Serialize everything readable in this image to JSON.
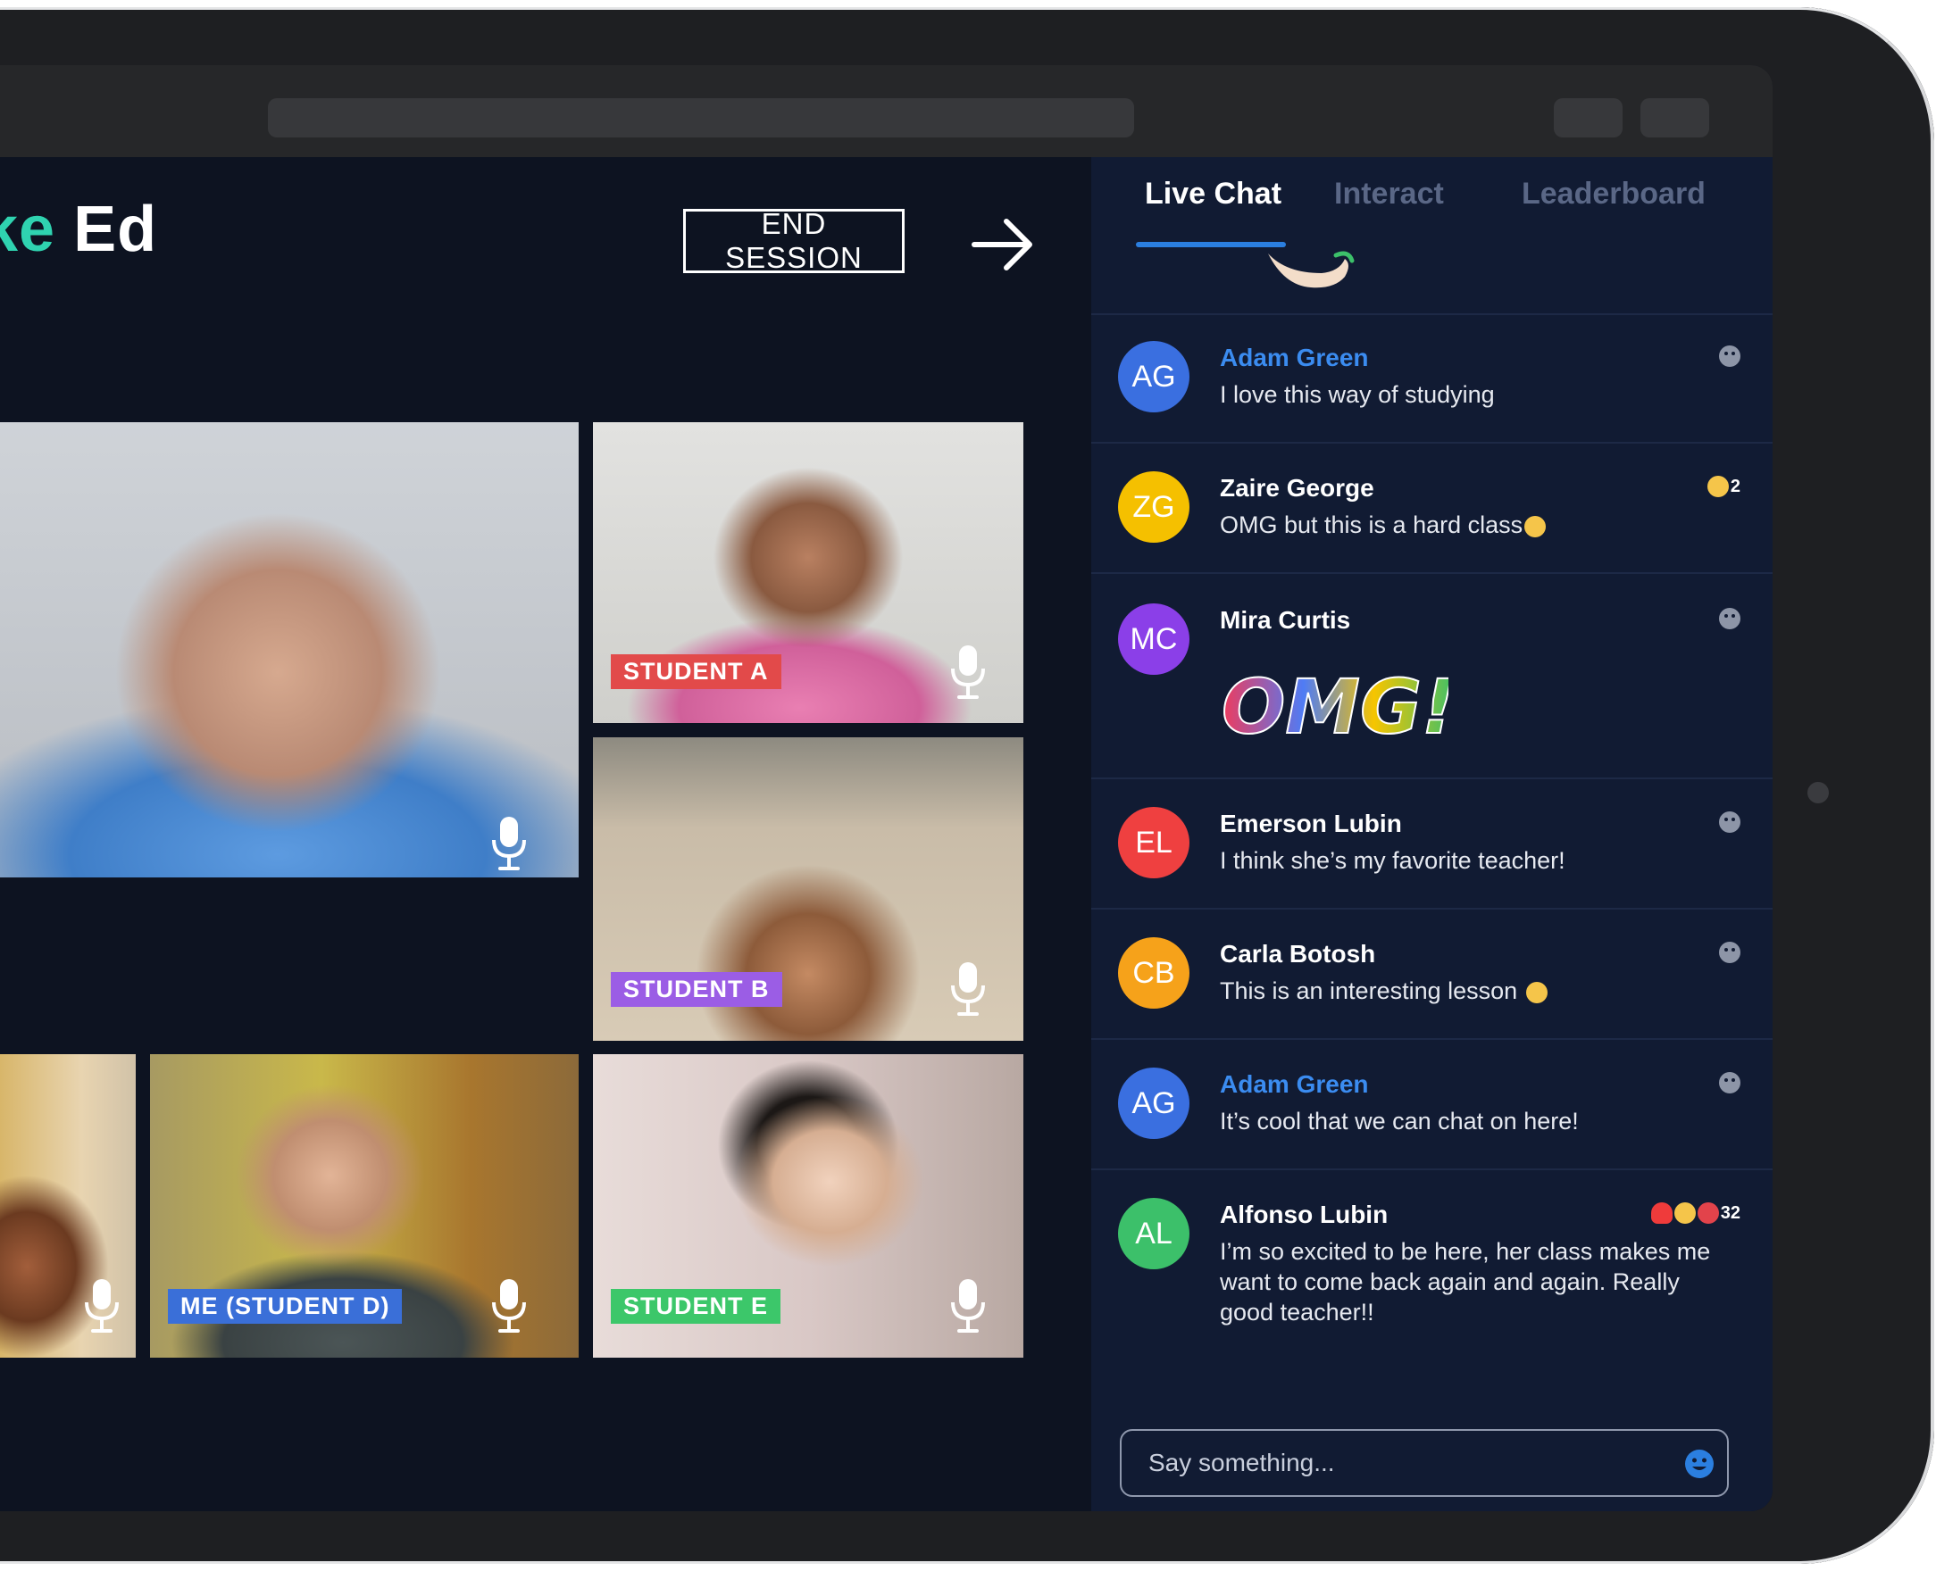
{
  "app": {
    "logo_accent": "ke",
    "logo_rest": "Ed",
    "end_session_label": "END SESSION"
  },
  "tiles": [
    {
      "id": "teacher",
      "label": ""
    },
    {
      "id": "student-a",
      "label": "STUDENT A",
      "tag_color": "#e24a4a"
    },
    {
      "id": "student-b",
      "label": "STUDENT B",
      "tag_color": "#9b5de5"
    },
    {
      "id": "student-c",
      "label": ""
    },
    {
      "id": "student-d",
      "label": "ME (STUDENT D)",
      "tag_color": "#3a6fd8"
    },
    {
      "id": "student-e",
      "label": "STUDENT E",
      "tag_color": "#3cc76a"
    }
  ],
  "chat": {
    "tabs": [
      {
        "label": "Live Chat",
        "active": true
      },
      {
        "label": "Interact",
        "active": false
      },
      {
        "label": "Leaderboard",
        "active": false
      }
    ],
    "messages": [
      {
        "initials": "AG",
        "name": "Adam Green",
        "avatar_color": "#3a6fe0",
        "text": "I love this way of studying"
      },
      {
        "initials": "ZG",
        "name": "Zaire George",
        "avatar_color": "#f5c000",
        "text": "OMG but this is a hard class",
        "reaction_count": "2"
      },
      {
        "initials": "MC",
        "name": "Mira Curtis",
        "avatar_color": "#8b3fe8",
        "sticker_text": "OMG!"
      },
      {
        "initials": "EL",
        "name": "Emerson Lubin",
        "avatar_color": "#ef4040",
        "text": "I think she’s my favorite teacher!"
      },
      {
        "initials": "CB",
        "name": "Carla Botosh",
        "avatar_color": "#f6a21a",
        "text": "This is an interesting lesson"
      },
      {
        "initials": "AG",
        "name": "Adam Green",
        "avatar_color": "#3a6fe0",
        "text": "It’s cool that we can chat on here!"
      },
      {
        "initials": "AL",
        "name": "Alfonso Lubin",
        "avatar_color": "#3cc06a",
        "text": "I’m so excited to be here, her class makes me want to come back again and again. Really good teacher!!",
        "reaction_count": "32"
      }
    ],
    "input_placeholder": "Say something..."
  }
}
